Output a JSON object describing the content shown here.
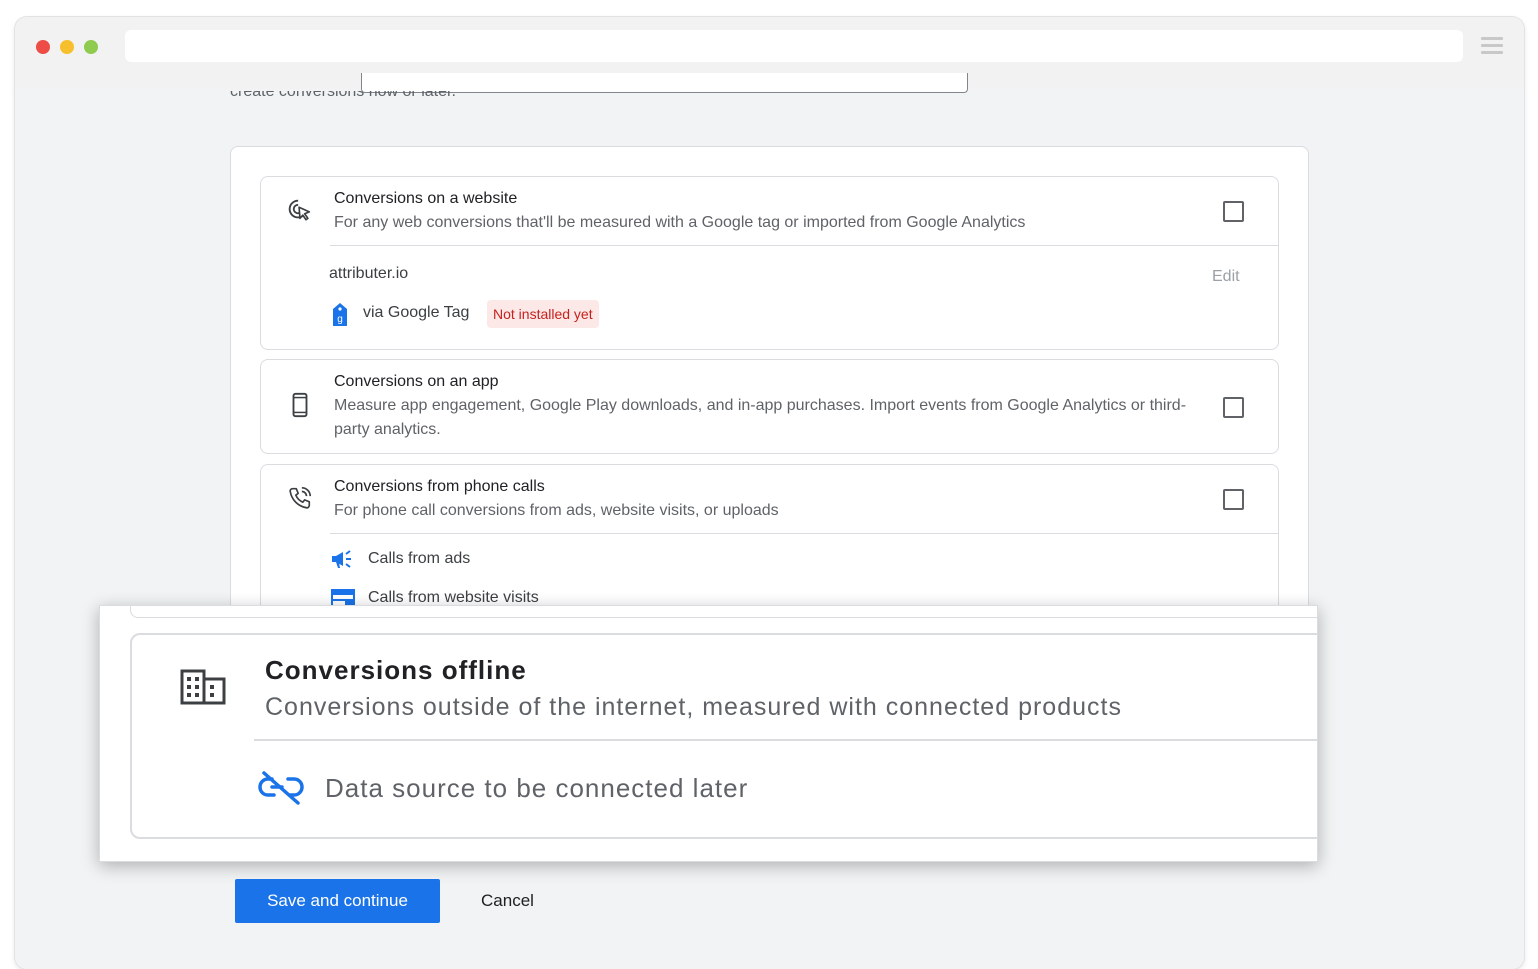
{
  "page": {
    "intro_text": "create conversions now or later."
  },
  "cards": {
    "website": {
      "title": "Conversions on a website",
      "description": "For any web conversions that'll be measured with a Google tag or imported from Google Analytics",
      "icon": "cursor-click-icon",
      "checked": false,
      "site": "attributer.io",
      "edit_label": "Edit",
      "source_label": "via Google Tag",
      "status_badge": "Not installed yet"
    },
    "app": {
      "title": "Conversions on an app",
      "description": "Measure app engagement, Google Play downloads, and in-app purchases. Import events from Google Analytics or third-party analytics.",
      "icon": "smartphone-icon",
      "checked": false
    },
    "phone": {
      "title": "Conversions from phone calls",
      "description": "For phone call conversions from ads, website visits, or uploads",
      "icon": "phone-call-icon",
      "checked": false,
      "items": [
        {
          "label": "Calls from ads",
          "icon": "megaphone-icon"
        },
        {
          "label": "Calls from website visits",
          "icon": "web-page-icon"
        }
      ]
    }
  },
  "offline_popup": {
    "title": "Conversions offline",
    "description": "Conversions outside of the internet, measured with connected products",
    "icon": "building-icon",
    "source_label": "Data source to be connected later",
    "source_icon": "link-off-icon"
  },
  "actions": {
    "save_label": "Save and continue",
    "cancel_label": "Cancel"
  },
  "colors": {
    "primary": "#1a73e8",
    "badge_bg": "#fce8e6",
    "badge_text": "#c5221f"
  }
}
